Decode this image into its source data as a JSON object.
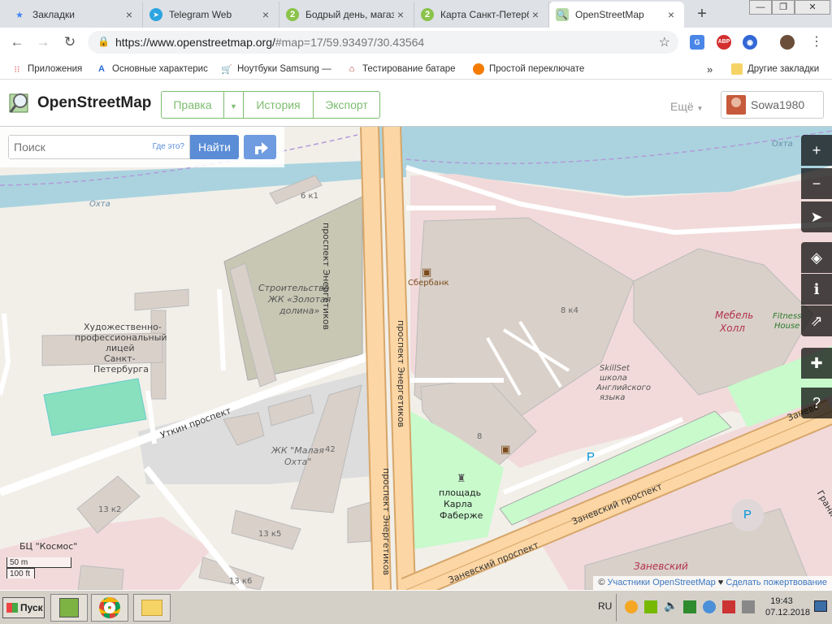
{
  "browser": {
    "tabs": [
      {
        "title": "Закладки",
        "icon": "star-icon"
      },
      {
        "title": "Telegram Web",
        "icon": "telegram-icon"
      },
      {
        "title": "Бодрый день, магаз",
        "icon": "green-logo-icon"
      },
      {
        "title": "Карта Санкт-Петерб",
        "icon": "green-logo-icon"
      },
      {
        "title": "OpenStreetMap",
        "icon": "osm-icon"
      }
    ],
    "new_tab": "+",
    "url_main": "https://www.openstreetmap.org/",
    "url_rest": "#map=17/59.93497/30.43564",
    "extensions": [
      "translate-icon",
      "adblock-icon",
      "globe-icon",
      "profile-icon"
    ],
    "adblock_label": "ABP"
  },
  "bookmarks": [
    {
      "label": "Приложения",
      "icon": "apps-grid-icon"
    },
    {
      "label": "Основные характерис",
      "icon": "letter-a-icon"
    },
    {
      "label": "Ноутбуки Samsung —",
      "icon": "cart-icon"
    },
    {
      "label": "Тестирование батаре",
      "icon": "house-icon"
    },
    {
      "label": "Простой переключате",
      "icon": "firefox-icon"
    }
  ],
  "bookmarks_overflow": "»",
  "other_bookmarks": "Другие закладки",
  "osm": {
    "logo_text": "OpenStreetMap",
    "edit": "Правка",
    "history": "История",
    "export": "Экспорт",
    "more": "Ещё",
    "username": "Sowa1980"
  },
  "search": {
    "placeholder": "Поиск",
    "where_is_this": "Где это?",
    "find_button": "Найти"
  },
  "map_labels": {
    "river1": "Охта",
    "river2": "Охта",
    "building_6k1": "6 к1",
    "construction": "Строительство",
    "construction2": "ЖК «Золотая",
    "construction3": "долина»",
    "lyceum1": "Художественно-",
    "lyceum2": "профессиональный",
    "lyceum3": "лицей",
    "lyceum4": "Санкт-",
    "lyceum5": "Петербурга",
    "utkin": "Уткин проспект",
    "malaya1": "ЖК \"Малая",
    "malaya2": "Охта\"",
    "num42": "42",
    "energetikov1": "проспект Энергетиков",
    "energetikov2": "проспект Энергетиков",
    "energetikov3": "проспект Энергетиков",
    "sberbank": "Сбербанк",
    "b8k4": "8 к4",
    "mebel1": "Мебель",
    "mebel2": "Холл",
    "fitness1": "Fitness",
    "fitness2": "House",
    "skillset1": "SkillSet",
    "skillset2": "школа",
    "skillset3": "Английского",
    "skillset4": "языка",
    "num8": "8",
    "square1": "площадь",
    "square2": "Карла",
    "square3": "Фаберже",
    "b13k2": "13 к2",
    "b13k5": "13 к5",
    "b13k6": "13 к6",
    "kosmos": "БЦ \"Космос\"",
    "zanevsky1": "Заневский проспект",
    "zanevsky2": "Заневский проспект",
    "zanevsky3": "Заневс",
    "zanevsky_mall": "Заневский",
    "granit": "Гранит",
    "parking": "P"
  },
  "scale": {
    "metric": "50 m",
    "imperial": "100 ft"
  },
  "attribution": {
    "prefix": "© ",
    "contributors": "Участники OpenStreetMap",
    "heart": " ♥ ",
    "donate": "Сделать пожертвование"
  },
  "map_controls": [
    "zoom-in-icon",
    "zoom-out-icon",
    "locate-icon",
    "layers-icon",
    "info-icon",
    "share-icon",
    "note-icon",
    "query-icon"
  ],
  "taskbar": {
    "start": "Пуск",
    "lang": "RU",
    "time": "19:43",
    "date": "07.12.2018"
  },
  "colors": {
    "osm_green": "#7ebc6f",
    "water": "#aad3df",
    "road_major": "#fcd6a4",
    "road_border": "#d6a66a",
    "building": "#d9d0c9",
    "construction": "#c7c7b4",
    "pink_area": "#f2dada",
    "park": "#c8facc",
    "pitch": "#88e0be"
  }
}
